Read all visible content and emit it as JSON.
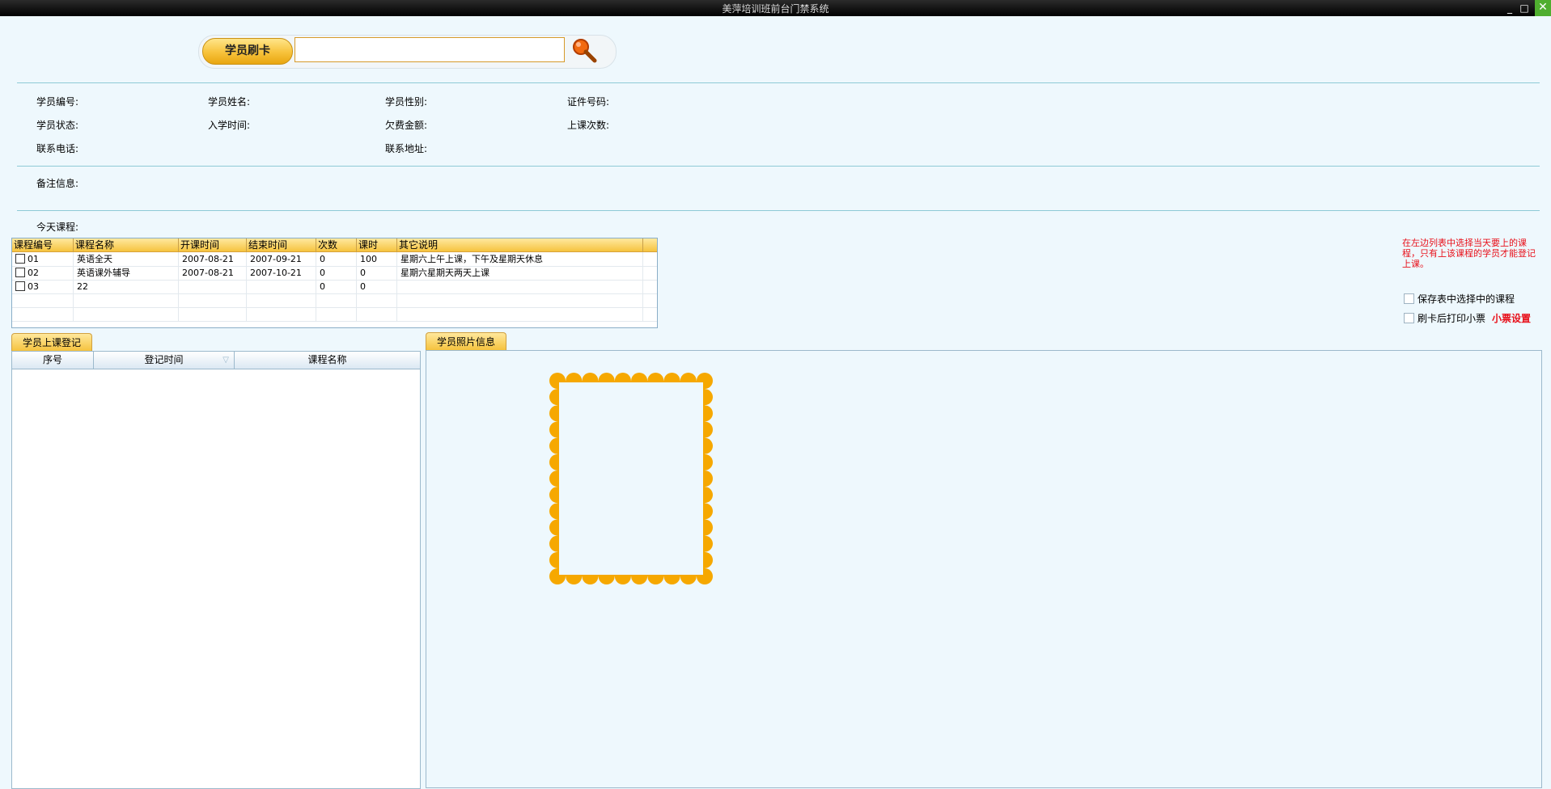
{
  "window": {
    "title": "美萍培训班前台门禁系统",
    "minimize_icon": "minimize-icon",
    "maximize_icon": "maximize-icon",
    "close_icon": "close-icon"
  },
  "search": {
    "card_button_label": "学员刷卡",
    "input_value": "",
    "search_icon": "magnifier-icon"
  },
  "student_info": {
    "id_label": "学员编号:",
    "name_label": "学员姓名:",
    "gender_label": "学员性别:",
    "idcard_label": "证件号码:",
    "status_label": "学员状态:",
    "enroll_label": "入学时间:",
    "debt_label": "欠费金额:",
    "attend_label": "上课次数:",
    "phone_label": "联系电话:",
    "address_label": "联系地址:",
    "remark_label": "备注信息:",
    "today_courses_label": "今天课程:"
  },
  "course_table": {
    "columns": [
      "课程编号",
      "课程名称",
      "开课时间",
      "结束时间",
      "次数",
      "课时",
      "其它说明"
    ],
    "rows": [
      {
        "id": "01",
        "name": "英语全天",
        "start": "2007-08-21",
        "end": "2007-09-21",
        "times": "0",
        "hours": "100",
        "note": "星期六上午上课，下午及星期天休息"
      },
      {
        "id": "02",
        "name": "英语课外辅导",
        "start": "2007-08-21",
        "end": "2007-10-21",
        "times": "0",
        "hours": "0",
        "note": "星期六星期天两天上课"
      },
      {
        "id": "03",
        "name": "22",
        "start": "",
        "end": "",
        "times": "0",
        "hours": "0",
        "note": ""
      }
    ]
  },
  "side_options": {
    "note": "在左边列表中选择当天要上的课程，只有上该课程的学员才能登记上课。",
    "save_selected_label": "保存表中选择中的课程",
    "print_ticket_label": "刷卡后打印小票",
    "ticket_settings_label": "小票设置"
  },
  "register_panel": {
    "tab_label": "学员上课登记",
    "columns": [
      "序号",
      "登记时间",
      "课程名称"
    ]
  },
  "photo_panel": {
    "tab_label": "学员照片信息"
  },
  "colors": {
    "background": "#eef8fd",
    "accent_orange": "#f6a800",
    "alert_red": "#e8101a"
  }
}
